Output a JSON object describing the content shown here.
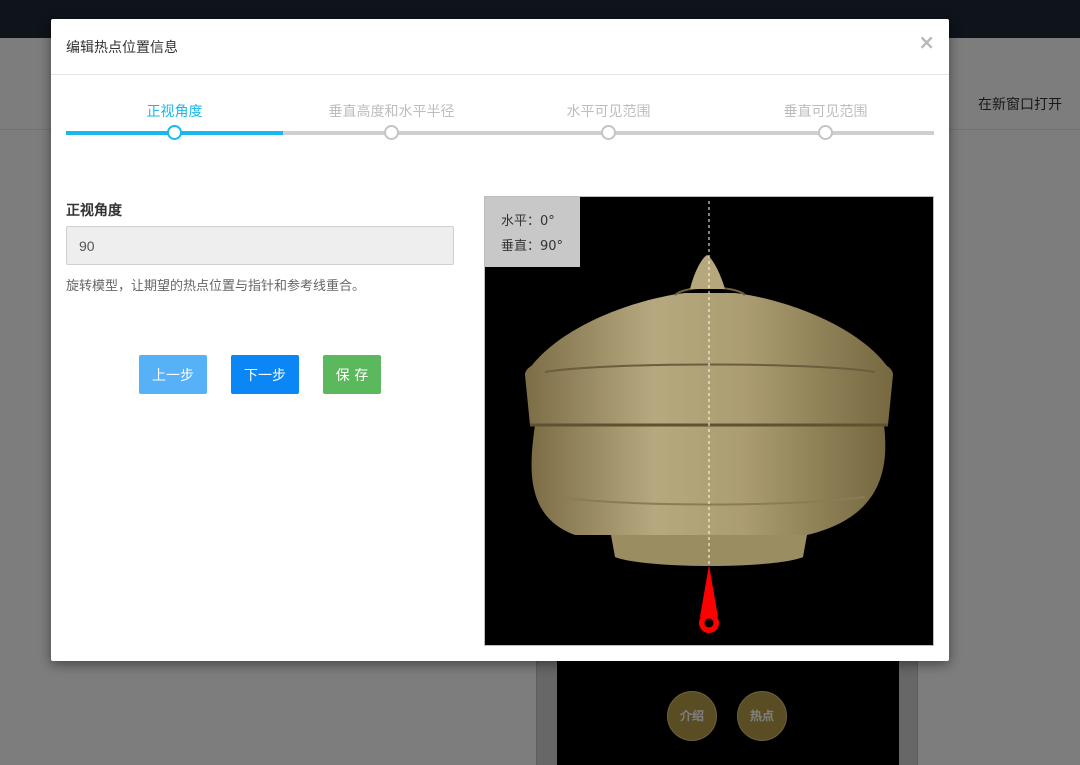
{
  "background": {
    "open_new_window": "在新窗口打开",
    "intro_button": "介绍",
    "hotspot_button": "热点"
  },
  "modal": {
    "title": "编辑热点位置信息",
    "close_symbol": "×"
  },
  "steps": [
    {
      "label": "正视角度",
      "active": true
    },
    {
      "label": "垂直高度和水平半径",
      "active": false
    },
    {
      "label": "水平可见范围",
      "active": false
    },
    {
      "label": "垂直可见范围",
      "active": false
    }
  ],
  "form": {
    "label": "正视角度",
    "value": "90",
    "help": "旋转模型，让期望的热点位置与指针和参考线重合。"
  },
  "buttons": {
    "prev": "上一步",
    "next": "下一步",
    "save": "保 存"
  },
  "viewer": {
    "horizontal": "水平：0°",
    "vertical": "垂直：90°"
  },
  "colors": {
    "accent": "#1ab7ea",
    "topbar": "#1e2634",
    "btn_prev": "#56b1f7",
    "btn_next": "#0b87f5",
    "btn_save": "#5cb85c",
    "pointer": "#ff0000",
    "model": "#a89a6e"
  },
  "icons": {
    "close": "close-icon",
    "pointer": "pointer-icon"
  }
}
